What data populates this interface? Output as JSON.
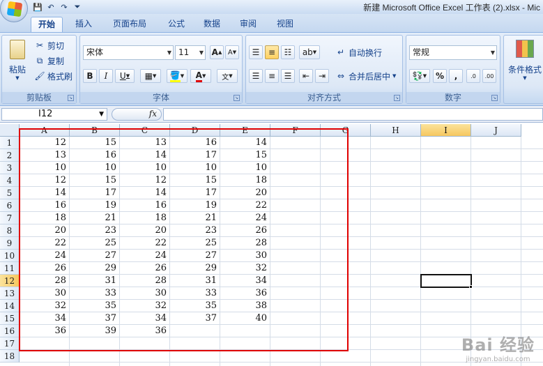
{
  "window": {
    "title": "新建 Microsoft Office Excel 工作表 (2).xlsx - Mic"
  },
  "quick_access": [
    "save-icon",
    "undo-icon",
    "redo-icon",
    "customize-icon"
  ],
  "tabs": [
    "开始",
    "插入",
    "页面布局",
    "公式",
    "数据",
    "审阅",
    "视图"
  ],
  "active_tab": "开始",
  "ribbon": {
    "clipboard": {
      "paste": "粘贴",
      "cut": "剪切",
      "copy": "复制",
      "format_painter": "格式刷",
      "label": "剪贴板"
    },
    "font": {
      "font_name": "宋体",
      "font_size": "11",
      "grow": "A",
      "shrink": "A",
      "bold": "B",
      "italic": "I",
      "underline": "U",
      "label": "字体"
    },
    "alignment": {
      "wrap_text": "自动换行",
      "merge_center": "合并后居中",
      "label": "对齐方式"
    },
    "number": {
      "format": "常规",
      "percent": "%",
      "comma": ",",
      "label": "数字"
    },
    "styles": {
      "conditional_format": "条件格式"
    }
  },
  "formula_bar": {
    "name_box": "I12",
    "fx": "fx",
    "formula": ""
  },
  "sheet": {
    "columns": [
      "A",
      "B",
      "C",
      "D",
      "E",
      "F",
      "G",
      "H",
      "I",
      "J"
    ],
    "rows": [
      "1",
      "2",
      "3",
      "4",
      "5",
      "6",
      "7",
      "8",
      "9",
      "10",
      "11",
      "12",
      "13",
      "14",
      "15",
      "16",
      "17",
      "18"
    ],
    "selected_column": "I",
    "selected_row": "12",
    "cells": [
      [
        "12",
        "15",
        "13",
        "16",
        "14"
      ],
      [
        "13",
        "16",
        "14",
        "17",
        "15"
      ],
      [
        "10",
        "10",
        "10",
        "10",
        "10"
      ],
      [
        "12",
        "15",
        "12",
        "15",
        "18"
      ],
      [
        "14",
        "17",
        "14",
        "17",
        "20"
      ],
      [
        "16",
        "19",
        "16",
        "19",
        "22"
      ],
      [
        "18",
        "21",
        "18",
        "21",
        "24"
      ],
      [
        "20",
        "23",
        "20",
        "23",
        "26"
      ],
      [
        "22",
        "25",
        "22",
        "25",
        "28"
      ],
      [
        "24",
        "27",
        "24",
        "27",
        "30"
      ],
      [
        "26",
        "29",
        "26",
        "29",
        "32"
      ],
      [
        "28",
        "31",
        "28",
        "31",
        "34"
      ],
      [
        "30",
        "33",
        "30",
        "33",
        "36"
      ],
      [
        "32",
        "35",
        "32",
        "35",
        "38"
      ],
      [
        "34",
        "37",
        "34",
        "37",
        "40"
      ],
      [
        "36",
        "39",
        "36",
        "",
        ""
      ],
      [
        "",
        "",
        "",
        "",
        ""
      ],
      [
        "",
        "",
        "",
        "",
        ""
      ]
    ]
  },
  "annotation": {
    "color": "#e00000"
  },
  "watermark": {
    "main": "Bai 经验",
    "sub": "jingyan.baidu.com"
  },
  "colors": {
    "accent": "#15428b",
    "selected_header": "#f6c75f"
  }
}
